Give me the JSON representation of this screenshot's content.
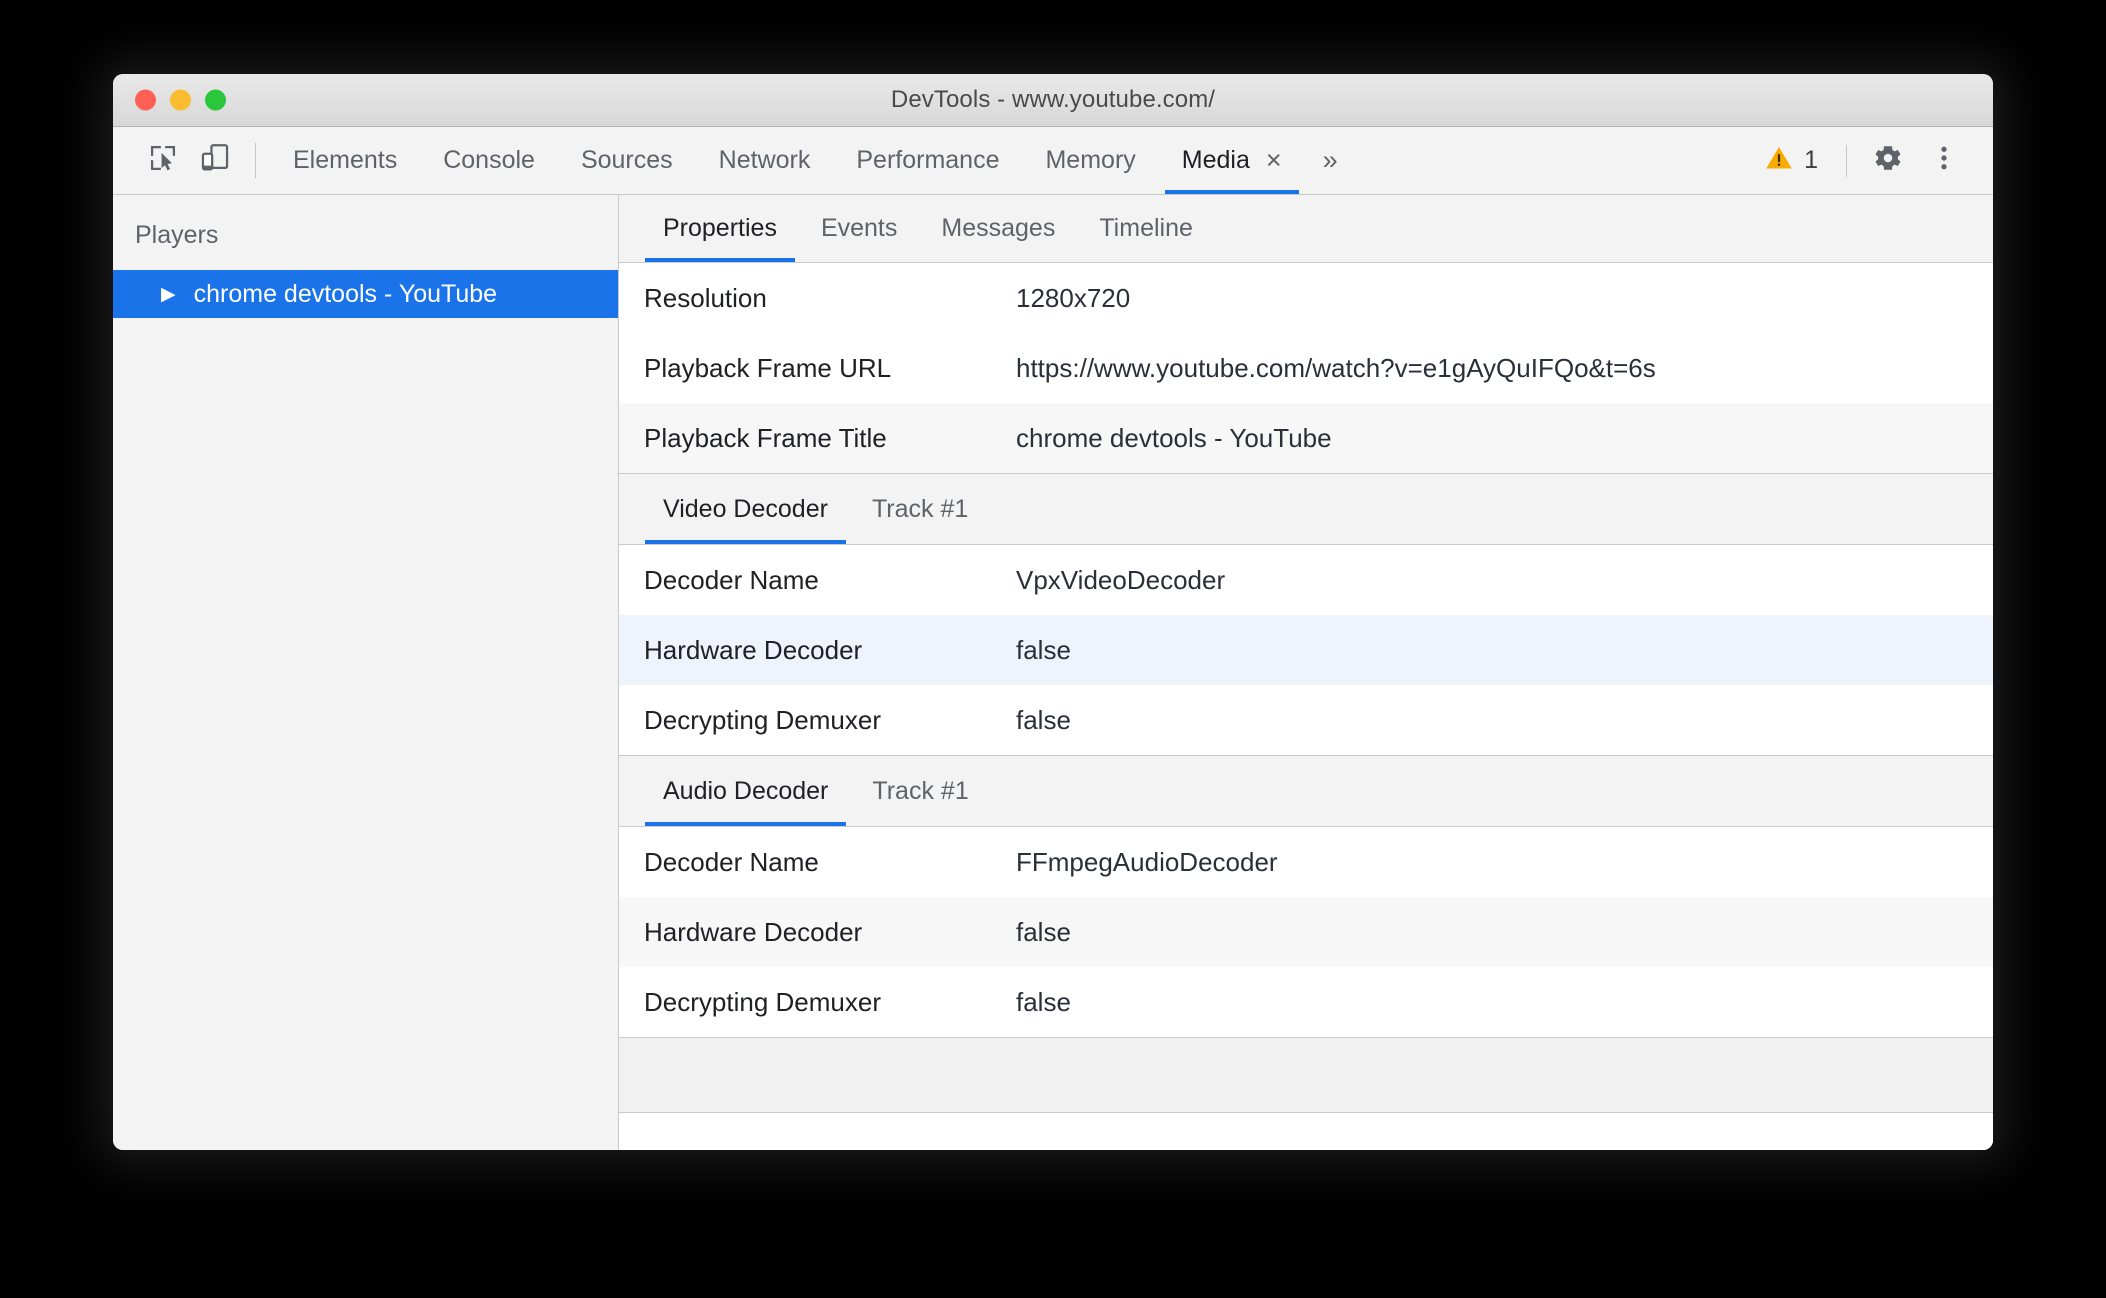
{
  "window": {
    "title": "DevTools - www.youtube.com/",
    "traffic_lights": [
      "close-red",
      "minimize-yellow",
      "zoom-green"
    ]
  },
  "toolbar": {
    "inspect_icon": "inspect-element-icon",
    "device_icon": "device-toolbar-icon",
    "tabs": [
      {
        "label": "Elements",
        "active": false,
        "closable": false
      },
      {
        "label": "Console",
        "active": false,
        "closable": false
      },
      {
        "label": "Sources",
        "active": false,
        "closable": false
      },
      {
        "label": "Network",
        "active": false,
        "closable": false
      },
      {
        "label": "Performance",
        "active": false,
        "closable": false
      },
      {
        "label": "Memory",
        "active": false,
        "closable": false
      },
      {
        "label": "Media",
        "active": true,
        "closable": true
      }
    ],
    "close_glyph": "×",
    "more_tabs_glyph": "»",
    "warning_icon": "warning-triangle-icon",
    "warning_count": "1",
    "settings_icon": "gear-icon",
    "menu_icon": "kebab-menu-icon",
    "accent_color": "#1a73e8",
    "warning_color": "#f9ab00"
  },
  "sidebar": {
    "title": "Players",
    "players": [
      {
        "label": "chrome devtools - YouTube",
        "expand_glyph": "▶",
        "selected": true
      }
    ],
    "selected_bg": "#1a73e8"
  },
  "panel": {
    "tabs": [
      {
        "label": "Properties",
        "active": true
      },
      {
        "label": "Events",
        "active": false
      },
      {
        "label": "Messages",
        "active": false
      },
      {
        "label": "Timeline",
        "active": false
      }
    ]
  },
  "properties": {
    "general": [
      {
        "name": "Resolution",
        "value": "1280x720",
        "style": "plain"
      },
      {
        "name": "Playback Frame URL",
        "value": "https://www.youtube.com/watch?v=e1gAyQuIFQo&t=6s",
        "style": "plain"
      },
      {
        "name": "Playback Frame Title",
        "value": "chrome devtools - YouTube",
        "style": "alt"
      }
    ],
    "video_decoder": {
      "header": {
        "title": "Video Decoder",
        "track": "Track #1"
      },
      "rows": [
        {
          "name": "Decoder Name",
          "value": "VpxVideoDecoder",
          "style": "plain"
        },
        {
          "name": "Hardware Decoder",
          "value": "false",
          "style": "highlight"
        },
        {
          "name": "Decrypting Demuxer",
          "value": "false",
          "style": "plain"
        }
      ]
    },
    "audio_decoder": {
      "header": {
        "title": "Audio Decoder",
        "track": "Track #1"
      },
      "rows": [
        {
          "name": "Decoder Name",
          "value": "FFmpegAudioDecoder",
          "style": "plain"
        },
        {
          "name": "Hardware Decoder",
          "value": "false",
          "style": "alt"
        },
        {
          "name": "Decrypting Demuxer",
          "value": "false",
          "style": "plain"
        }
      ]
    }
  }
}
